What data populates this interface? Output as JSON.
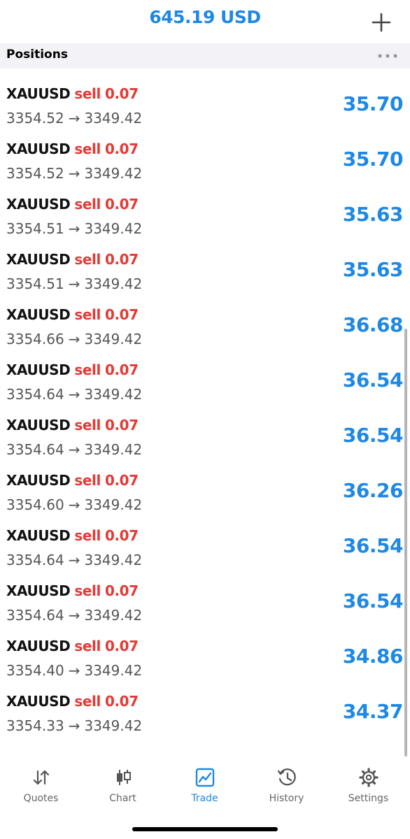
{
  "header": {
    "balance": "645.19 USD",
    "accent_color": "#1e88e5",
    "plus_icon": "plus-icon"
  },
  "section": {
    "title": "Positions",
    "more_icon": "more-dots-icon"
  },
  "positions": [
    {
      "symbol": "XAUUSD",
      "side": "sell",
      "volume": "0.07",
      "open_price": "3354.52",
      "current_price": "3349.42",
      "profit": "35.70"
    },
    {
      "symbol": "XAUUSD",
      "side": "sell",
      "volume": "0.07",
      "open_price": "3354.52",
      "current_price": "3349.42",
      "profit": "35.70"
    },
    {
      "symbol": "XAUUSD",
      "side": "sell",
      "volume": "0.07",
      "open_price": "3354.51",
      "current_price": "3349.42",
      "profit": "35.63"
    },
    {
      "symbol": "XAUUSD",
      "side": "sell",
      "volume": "0.07",
      "open_price": "3354.51",
      "current_price": "3349.42",
      "profit": "35.63"
    },
    {
      "symbol": "XAUUSD",
      "side": "sell",
      "volume": "0.07",
      "open_price": "3354.66",
      "current_price": "3349.42",
      "profit": "36.68"
    },
    {
      "symbol": "XAUUSD",
      "side": "sell",
      "volume": "0.07",
      "open_price": "3354.64",
      "current_price": "3349.42",
      "profit": "36.54"
    },
    {
      "symbol": "XAUUSD",
      "side": "sell",
      "volume": "0.07",
      "open_price": "3354.64",
      "current_price": "3349.42",
      "profit": "36.54"
    },
    {
      "symbol": "XAUUSD",
      "side": "sell",
      "volume": "0.07",
      "open_price": "3354.60",
      "current_price": "3349.42",
      "profit": "36.26"
    },
    {
      "symbol": "XAUUSD",
      "side": "sell",
      "volume": "0.07",
      "open_price": "3354.64",
      "current_price": "3349.42",
      "profit": "36.54"
    },
    {
      "symbol": "XAUUSD",
      "side": "sell",
      "volume": "0.07",
      "open_price": "3354.64",
      "current_price": "3349.42",
      "profit": "36.54"
    },
    {
      "symbol": "XAUUSD",
      "side": "sell",
      "volume": "0.07",
      "open_price": "3354.40",
      "current_price": "3349.42",
      "profit": "34.86"
    },
    {
      "symbol": "XAUUSD",
      "side": "sell",
      "volume": "0.07",
      "open_price": "3354.33",
      "current_price": "3349.42",
      "profit": "34.37"
    }
  ],
  "arrow_glyph": "→",
  "colors": {
    "sell": "#e53935",
    "profit": "#1e88e5",
    "section_bg": "#f2f2f7"
  },
  "tabbar": {
    "tabs": [
      {
        "label": "Quotes",
        "icon": "quotes-arrows-icon",
        "active": false
      },
      {
        "label": "Chart",
        "icon": "candlestick-chart-icon",
        "active": false
      },
      {
        "label": "Trade",
        "icon": "trade-chart-icon",
        "active": true
      },
      {
        "label": "History",
        "icon": "history-clock-icon",
        "active": false
      },
      {
        "label": "Settings",
        "icon": "settings-gear-icon",
        "active": false
      }
    ]
  }
}
